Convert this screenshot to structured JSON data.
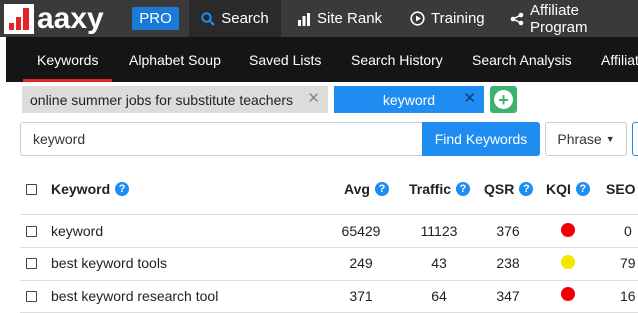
{
  "brand": {
    "logo_text": "aaxy",
    "badge": "PRO"
  },
  "nav": {
    "search": "Search",
    "site_rank": "Site Rank",
    "training": "Training",
    "affiliate": "Affiliate Program"
  },
  "subnav": {
    "keywords": "Keywords",
    "alphabet_soup": "Alphabet Soup",
    "saved_lists": "Saved Lists",
    "search_history": "Search History",
    "search_analysis": "Search Analysis",
    "affiliate_cut": "Affiliat"
  },
  "keyword_tabs": [
    {
      "label": "online summer jobs for substitute teachers",
      "close": "✕"
    },
    {
      "label": "keyword",
      "close": "✕"
    }
  ],
  "search": {
    "value": "keyword",
    "find_button": "Find Keywords",
    "phrase_button": "Phrase"
  },
  "table": {
    "headers": {
      "keyword": "Keyword",
      "avg": "Avg",
      "traffic": "Traffic",
      "qsr": "QSR",
      "kqi": "KQI",
      "seo": "SEO"
    },
    "rows": [
      {
        "keyword": "keyword",
        "avg": "65429",
        "traffic": "11123",
        "qsr": "376",
        "kqi": "red",
        "seo": "0"
      },
      {
        "keyword": "best keyword tools",
        "avg": "249",
        "traffic": "43",
        "qsr": "238",
        "kqi": "yellow",
        "seo": "79"
      },
      {
        "keyword": "best keyword research tool",
        "avg": "371",
        "traffic": "64",
        "qsr": "347",
        "kqi": "red",
        "seo": "16"
      }
    ]
  },
  "colors": {
    "accent_blue": "#1e8cf0",
    "brand_red": "#e52226",
    "kqi_red": "#ee0000",
    "kqi_yellow": "#f5e600",
    "add_green": "#3cb371"
  },
  "icons": {
    "search": "search-icon",
    "site_rank": "bar-chart-icon",
    "training": "play-circle-icon",
    "affiliate": "share-icon",
    "add": "plus-circle-icon",
    "help": "question-icon"
  }
}
